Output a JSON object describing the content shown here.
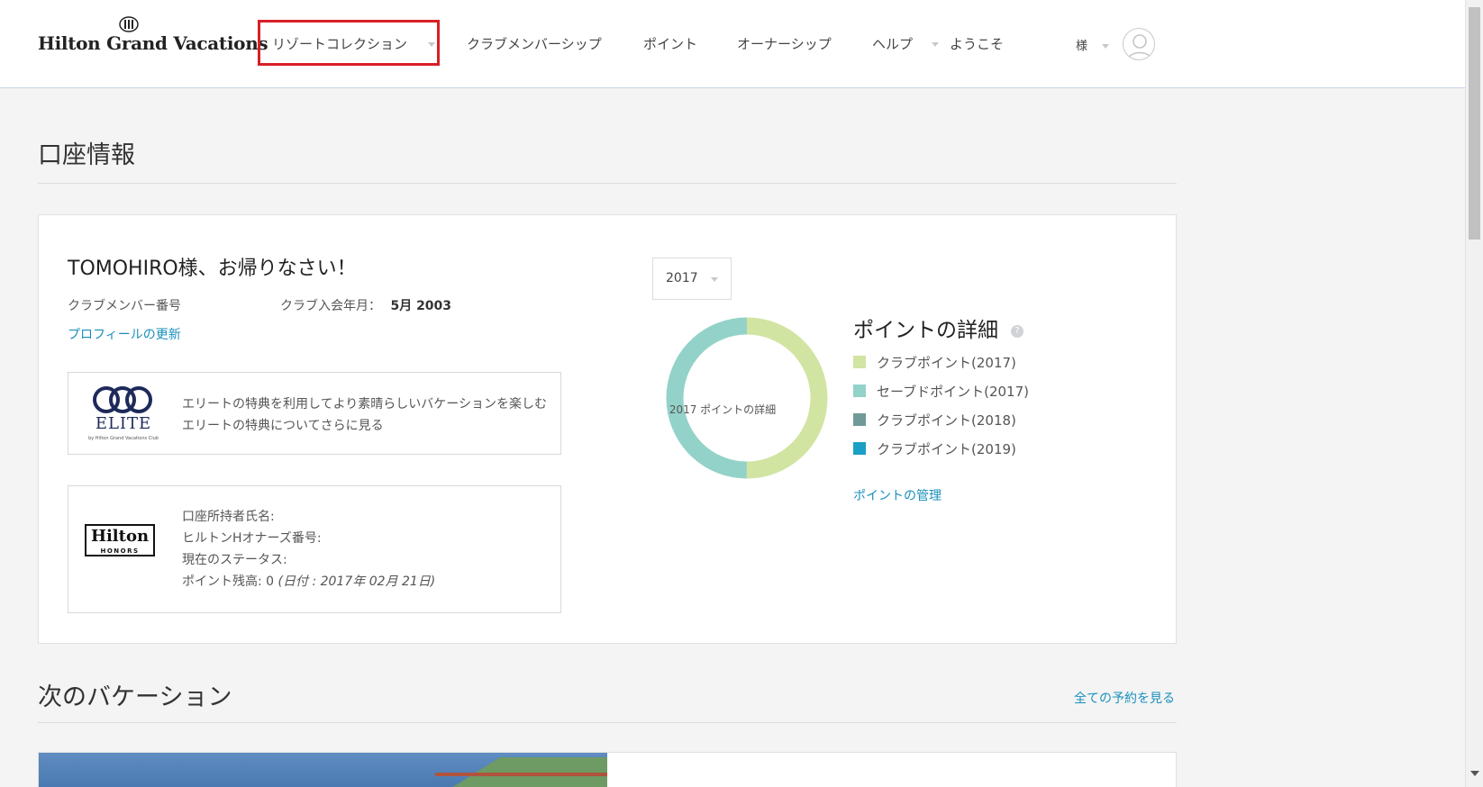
{
  "header": {
    "logo_text": "Hilton Grand Vacations",
    "nav": [
      {
        "label": "リゾートコレクション"
      },
      {
        "label": "クラブメンバーシップ"
      },
      {
        "label": "ポイント"
      },
      {
        "label": "オーナーシップ"
      },
      {
        "label": "ヘルプ"
      }
    ],
    "welcome": "ようこそ",
    "user_suffix": "様"
  },
  "account": {
    "title": "口座情報",
    "greeting": "TOMOHIRO様、お帰りなさい！",
    "member_number_label": "クラブメンバー番号",
    "join_date_label": "クラブ入会年月：",
    "join_date_value": "5月 2003",
    "update_profile_link": "プロフィールの更新",
    "elite": {
      "logo_text": "ELITE",
      "logo_sub": "by Hilton Grand Vacations Club",
      "description": "エリートの特典を利用してより素晴らしいバケーションを楽しむ",
      "link": "エリートの特典についてさらに見る"
    },
    "honors": {
      "logo_text": "Hilton",
      "logo_sub": "HONORS",
      "holder_name_label": "口座所持者氏名:",
      "honors_number_label": "ヒルトンHオナーズ番号:",
      "status_label": "現在のステータス:",
      "balance_label": "ポイント残高: 0",
      "balance_date": "(日付 : 2017年 02月 21日)"
    }
  },
  "points": {
    "year_selected": "2017",
    "title": "ポイントの詳細",
    "help_icon": "?",
    "donut_label": "2017 ポイントの詳細",
    "manage_link": "ポイントの管理",
    "legend": [
      {
        "label": "クラブポイント(2017)",
        "color": "#d2e4a2"
      },
      {
        "label": "セーブドポイント(2017)",
        "color": "#93d2c8"
      },
      {
        "label": "クラブポイント(2018)",
        "color": "#6f9a98"
      },
      {
        "label": "クラブポイント(2019)",
        "color": "#1aa0c4"
      }
    ]
  },
  "chart_data": {
    "type": "pie",
    "categories": [
      "クラブポイント(2017)",
      "セーブドポイント(2017)",
      "クラブポイント(2018)",
      "クラブポイント(2019)"
    ],
    "values": [
      50,
      50,
      0,
      0
    ]
  },
  "vacation": {
    "title": "次のバケーション",
    "see_all_link": "全ての予約を見る"
  },
  "colors": {
    "accent_link": "#1a8fbd",
    "highlight_border": "#d81f26"
  }
}
